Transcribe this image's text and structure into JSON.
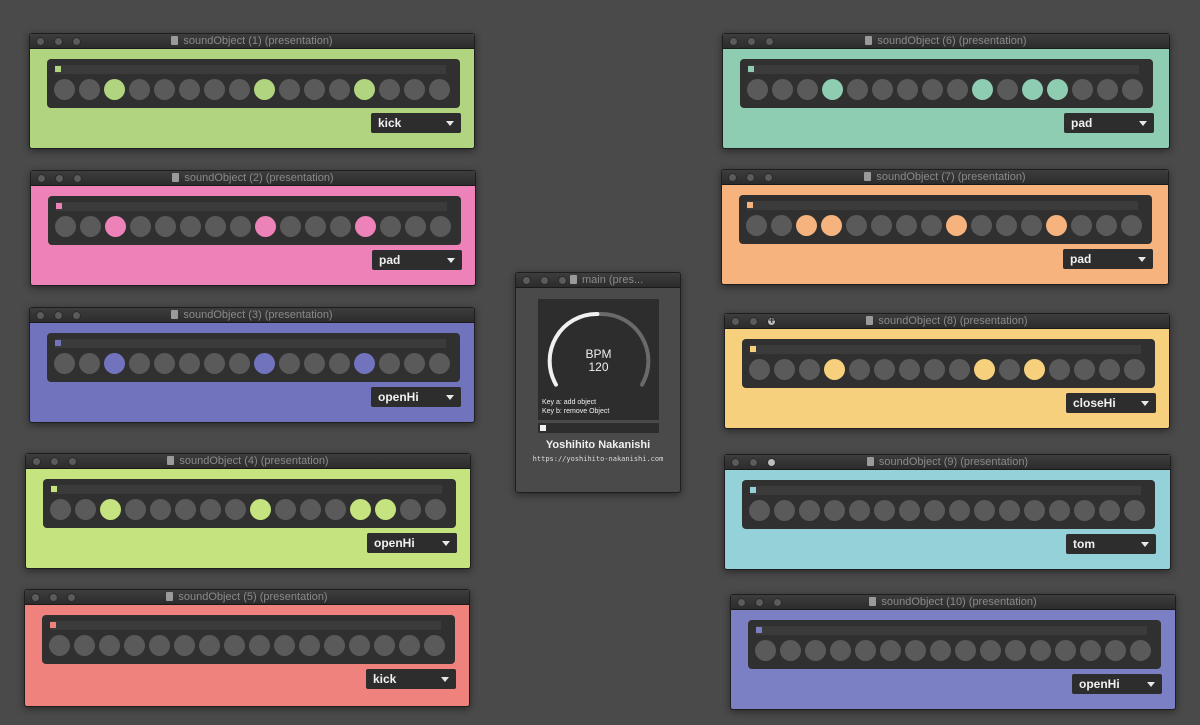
{
  "colors": {
    "green": "#b0d47f",
    "pink": "#ec82b7",
    "periwinkle": "#7174bd",
    "lime": "#c5e37e",
    "salmon": "#ef827c",
    "teal": "#8ecdb1",
    "orange": "#f6b37e",
    "yellow": "#f7d07e",
    "cyan": "#94d1d9",
    "blue": "#7b7fc3",
    "step_off": "#5a5a5a"
  },
  "windows": [
    {
      "title": "soundObject (1) (presentation)",
      "instrument": "kick",
      "color": "#b0d47f",
      "steps": [
        0,
        0,
        1,
        0,
        0,
        0,
        0,
        0,
        1,
        0,
        0,
        0,
        1,
        0,
        0,
        0
      ]
    },
    {
      "title": "soundObject (2) (presentation)",
      "instrument": "pad",
      "color": "#ec82b7",
      "steps": [
        0,
        0,
        1,
        0,
        0,
        0,
        0,
        0,
        1,
        0,
        0,
        0,
        1,
        0,
        0,
        0
      ]
    },
    {
      "title": "soundObject (3) (presentation)",
      "instrument": "openHi",
      "color": "#7174bd",
      "steps": [
        0,
        0,
        1,
        0,
        0,
        0,
        0,
        0,
        1,
        0,
        0,
        0,
        1,
        0,
        0,
        0
      ]
    },
    {
      "title": "soundObject (4) (presentation)",
      "instrument": "openHi",
      "color": "#c5e37e",
      "steps": [
        0,
        0,
        1,
        0,
        0,
        0,
        0,
        0,
        1,
        0,
        0,
        0,
        1,
        1,
        0,
        0
      ]
    },
    {
      "title": "soundObject (5) (presentation)",
      "instrument": "kick",
      "color": "#ef827c",
      "steps": [
        0,
        0,
        0,
        0,
        0,
        0,
        0,
        0,
        0,
        0,
        0,
        0,
        0,
        0,
        0,
        0
      ]
    },
    {
      "title": "soundObject (6) (presentation)",
      "instrument": "pad",
      "color": "#8ecdb1",
      "steps": [
        0,
        0,
        0,
        1,
        0,
        0,
        0,
        0,
        0,
        1,
        0,
        1,
        1,
        0,
        0,
        0
      ]
    },
    {
      "title": "soundObject (7) (presentation)",
      "instrument": "pad",
      "color": "#f6b37e",
      "steps": [
        0,
        0,
        1,
        1,
        0,
        0,
        0,
        0,
        1,
        0,
        0,
        0,
        1,
        0,
        0,
        0
      ]
    },
    {
      "title": "soundObject (8) (presentation)",
      "instrument": "closeHi",
      "color": "#f7d07e",
      "steps": [
        0,
        0,
        0,
        1,
        0,
        0,
        0,
        0,
        0,
        1,
        0,
        1,
        0,
        0,
        0,
        0
      ]
    },
    {
      "title": "soundObject (9) (presentation)",
      "instrument": "tom",
      "color": "#94d1d9",
      "steps": [
        0,
        0,
        0,
        0,
        0,
        0,
        0,
        0,
        0,
        0,
        0,
        0,
        0,
        0,
        0,
        0
      ]
    },
    {
      "title": "soundObject (10) (presentation)",
      "instrument": "openHi",
      "color": "#7b7fc3",
      "steps": [
        0,
        0,
        0,
        0,
        0,
        0,
        0,
        0,
        0,
        0,
        0,
        0,
        0,
        0,
        0,
        0
      ]
    }
  ],
  "main": {
    "title": "main (pres...",
    "bpm_label": "BPM",
    "bpm_value": "120",
    "key_hint_a": "Key a: add object",
    "key_hint_b": "Key b: remove Object",
    "author": "Yoshihito Nakanishi",
    "url": "https://yoshihito-nakanishi.com"
  }
}
